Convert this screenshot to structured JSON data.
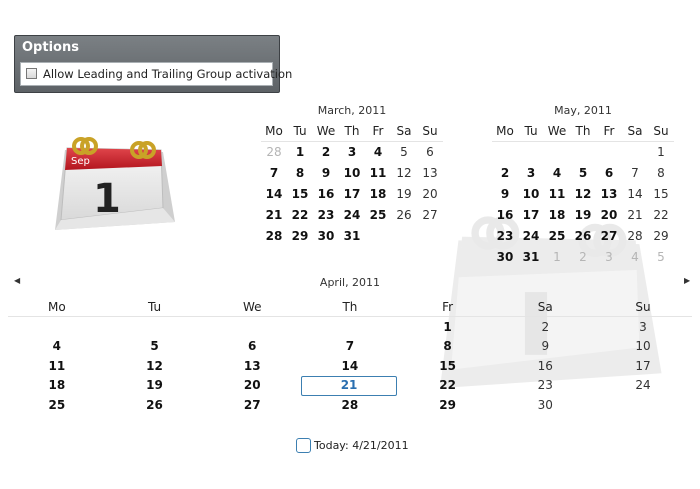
{
  "options": {
    "title": "Options",
    "checkbox_label": "Allow Leading and Trailing Group activation",
    "checked": false
  },
  "icon": {
    "month": "Sep",
    "day": "1"
  },
  "day_headers": [
    "Mo",
    "Tu",
    "We",
    "Th",
    "Fr",
    "Sa",
    "Su"
  ],
  "march": {
    "title": "March, 2011",
    "cells": [
      {
        "t": "28",
        "s": "g"
      },
      {
        "t": "1",
        "s": "b"
      },
      {
        "t": "2",
        "s": "b"
      },
      {
        "t": "3",
        "s": "b"
      },
      {
        "t": "4",
        "s": "b"
      },
      {
        "t": "5",
        "s": "n"
      },
      {
        "t": "6",
        "s": "n"
      },
      {
        "t": "7",
        "s": "b"
      },
      {
        "t": "8",
        "s": "b"
      },
      {
        "t": "9",
        "s": "b"
      },
      {
        "t": "10",
        "s": "b"
      },
      {
        "t": "11",
        "s": "b"
      },
      {
        "t": "12",
        "s": "n"
      },
      {
        "t": "13",
        "s": "n"
      },
      {
        "t": "14",
        "s": "b"
      },
      {
        "t": "15",
        "s": "b"
      },
      {
        "t": "16",
        "s": "b"
      },
      {
        "t": "17",
        "s": "b"
      },
      {
        "t": "18",
        "s": "b"
      },
      {
        "t": "19",
        "s": "n"
      },
      {
        "t": "20",
        "s": "n"
      },
      {
        "t": "21",
        "s": "b"
      },
      {
        "t": "22",
        "s": "b"
      },
      {
        "t": "23",
        "s": "b"
      },
      {
        "t": "24",
        "s": "b"
      },
      {
        "t": "25",
        "s": "b"
      },
      {
        "t": "26",
        "s": "n"
      },
      {
        "t": "27",
        "s": "n"
      },
      {
        "t": "28",
        "s": "b"
      },
      {
        "t": "29",
        "s": "b"
      },
      {
        "t": "30",
        "s": "b"
      },
      {
        "t": "31",
        "s": "b"
      },
      {
        "t": "",
        "s": "n"
      },
      {
        "t": "",
        "s": "n"
      },
      {
        "t": "",
        "s": "n"
      }
    ]
  },
  "may": {
    "title": "May, 2011",
    "cells": [
      {
        "t": "",
        "s": "n"
      },
      {
        "t": "",
        "s": "n"
      },
      {
        "t": "",
        "s": "n"
      },
      {
        "t": "",
        "s": "n"
      },
      {
        "t": "",
        "s": "n"
      },
      {
        "t": "",
        "s": "n"
      },
      {
        "t": "1",
        "s": "n"
      },
      {
        "t": "2",
        "s": "b"
      },
      {
        "t": "3",
        "s": "b"
      },
      {
        "t": "4",
        "s": "b"
      },
      {
        "t": "5",
        "s": "b"
      },
      {
        "t": "6",
        "s": "b"
      },
      {
        "t": "7",
        "s": "n"
      },
      {
        "t": "8",
        "s": "n"
      },
      {
        "t": "9",
        "s": "b"
      },
      {
        "t": "10",
        "s": "b"
      },
      {
        "t": "11",
        "s": "b"
      },
      {
        "t": "12",
        "s": "b"
      },
      {
        "t": "13",
        "s": "b"
      },
      {
        "t": "14",
        "s": "n"
      },
      {
        "t": "15",
        "s": "n"
      },
      {
        "t": "16",
        "s": "b"
      },
      {
        "t": "17",
        "s": "b"
      },
      {
        "t": "18",
        "s": "b"
      },
      {
        "t": "19",
        "s": "b"
      },
      {
        "t": "20",
        "s": "b"
      },
      {
        "t": "21",
        "s": "n"
      },
      {
        "t": "22",
        "s": "n"
      },
      {
        "t": "23",
        "s": "b"
      },
      {
        "t": "24",
        "s": "b"
      },
      {
        "t": "25",
        "s": "b"
      },
      {
        "t": "26",
        "s": "b"
      },
      {
        "t": "27",
        "s": "b"
      },
      {
        "t": "28",
        "s": "n"
      },
      {
        "t": "29",
        "s": "n"
      },
      {
        "t": "30",
        "s": "b"
      },
      {
        "t": "31",
        "s": "b"
      },
      {
        "t": "1",
        "s": "g"
      },
      {
        "t": "2",
        "s": "g"
      },
      {
        "t": "3",
        "s": "g"
      },
      {
        "t": "4",
        "s": "g"
      },
      {
        "t": "5",
        "s": "g"
      }
    ]
  },
  "april": {
    "title": "April, 2011",
    "cells": [
      {
        "t": "",
        "s": "n"
      },
      {
        "t": "",
        "s": "n"
      },
      {
        "t": "",
        "s": "n"
      },
      {
        "t": "",
        "s": "n"
      },
      {
        "t": "1",
        "s": "b"
      },
      {
        "t": "2",
        "s": "n"
      },
      {
        "t": "3",
        "s": "n"
      },
      {
        "t": "4",
        "s": "b"
      },
      {
        "t": "5",
        "s": "b"
      },
      {
        "t": "6",
        "s": "b"
      },
      {
        "t": "7",
        "s": "b"
      },
      {
        "t": "8",
        "s": "b"
      },
      {
        "t": "9",
        "s": "n"
      },
      {
        "t": "10",
        "s": "n"
      },
      {
        "t": "11",
        "s": "b"
      },
      {
        "t": "12",
        "s": "b"
      },
      {
        "t": "13",
        "s": "b"
      },
      {
        "t": "14",
        "s": "b"
      },
      {
        "t": "15",
        "s": "b"
      },
      {
        "t": "16",
        "s": "n"
      },
      {
        "t": "17",
        "s": "n"
      },
      {
        "t": "18",
        "s": "b"
      },
      {
        "t": "19",
        "s": "b"
      },
      {
        "t": "20",
        "s": "b"
      },
      {
        "t": "21",
        "s": "today"
      },
      {
        "t": "22",
        "s": "b"
      },
      {
        "t": "23",
        "s": "n"
      },
      {
        "t": "24",
        "s": "n"
      },
      {
        "t": "25",
        "s": "b"
      },
      {
        "t": "26",
        "s": "b"
      },
      {
        "t": "27",
        "s": "b"
      },
      {
        "t": "28",
        "s": "b"
      },
      {
        "t": "29",
        "s": "b"
      },
      {
        "t": "30",
        "s": "n"
      },
      {
        "t": "",
        "s": "n"
      }
    ]
  },
  "today_label": "Today: 4/21/2011",
  "colors": {
    "accent": "#3c7fb1",
    "icon_red": "#c8202a",
    "ring_gold": "#c9a227"
  }
}
